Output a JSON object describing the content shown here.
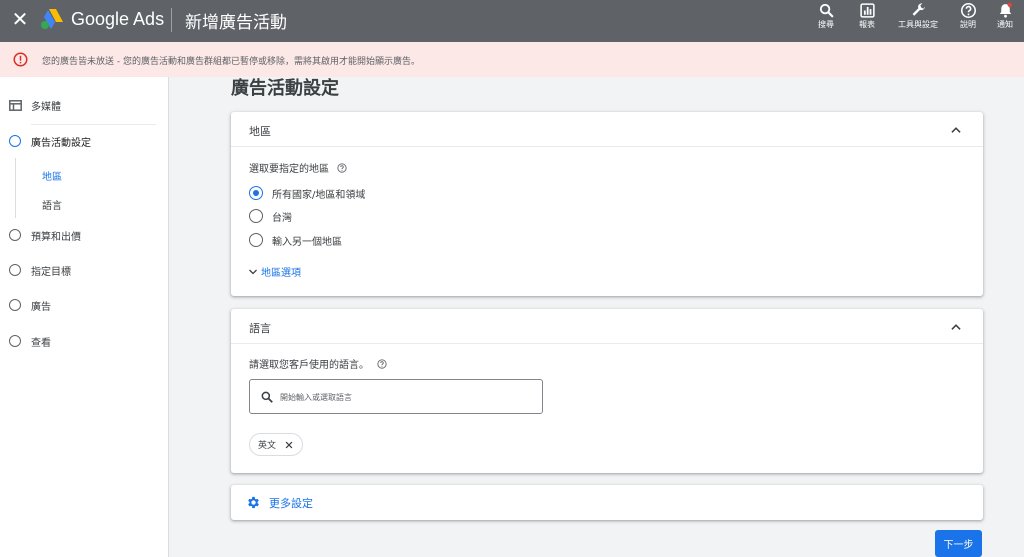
{
  "topbar": {
    "brand": "Google Ads",
    "page_heading": "新增廣告活動",
    "tools": [
      {
        "label": "搜尋",
        "icon": "search-icon"
      },
      {
        "label": "報表",
        "icon": "reports-icon"
      },
      {
        "label": "工具與設定",
        "icon": "wrench-icon"
      },
      {
        "label": "說明",
        "icon": "help-icon"
      },
      {
        "label": "通知",
        "icon": "bell-icon"
      }
    ]
  },
  "banner": {
    "text": "您的廣告皆未放送 - 您的廣告活動和廣告群組都已暫停或移除，需將其啟用才能開始顯示廣告。"
  },
  "sidebar": {
    "items": [
      {
        "label": "多媒體"
      },
      {
        "label": "廣告活動設定"
      },
      {
        "label": "預算和出價"
      },
      {
        "label": "指定目標"
      },
      {
        "label": "廣告"
      },
      {
        "label": "查看"
      }
    ],
    "sub_items": [
      {
        "label": "地區"
      },
      {
        "label": "語言"
      }
    ]
  },
  "main": {
    "title": "廣告活動設定",
    "location_card": {
      "title": "地區",
      "question": "選取要指定的地區",
      "options": [
        {
          "label": "所有國家/地區和領域",
          "checked": true
        },
        {
          "label": "台灣",
          "checked": false
        },
        {
          "label": "輸入另一個地區",
          "checked": false
        }
      ],
      "more_link": "地區選項"
    },
    "language_card": {
      "title": "語言",
      "question": "請選取您客戶使用的語言。",
      "search_placeholder": "開始輸入或選取語言",
      "chip": "英文"
    },
    "more_settings": "更多設定",
    "next_button": "下一步"
  },
  "colors": {
    "topbar": "#5f6368",
    "banner_bg": "#fce8e6",
    "banner_icon": "#d93025",
    "accent": "#1a73e8"
  }
}
